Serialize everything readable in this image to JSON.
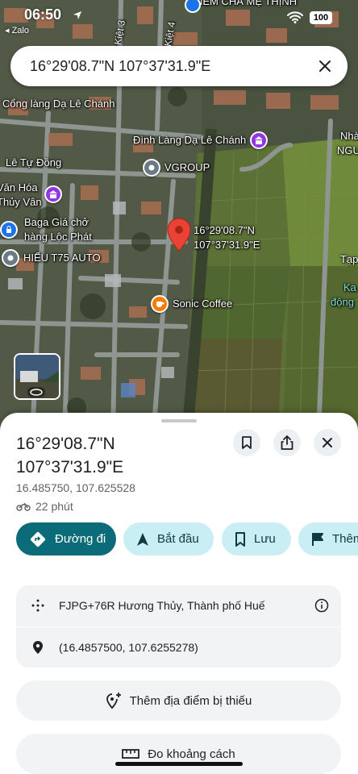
{
  "status_bar": {
    "time": "06:50",
    "back_app": "◂ Zalo",
    "battery": "100"
  },
  "search": {
    "query": "16°29'08.7\"N 107°37'31.9\"E"
  },
  "map": {
    "labels": {
      "nem_cha": "NEM CHẢ MẸ THỊNH",
      "kiet3": "Kiệt 3",
      "kiet4": "Kiệt 4",
      "cong_lang": "Cổng làng Dạ Lê Chánh",
      "dinh_lang": "Đình Làng Dạ Lê Chánh",
      "le_tu_dong": "Lê Tự Đồng",
      "vgroup": "VGROUP",
      "van_hoa_1": "Văn Hóa",
      "van_hoa_2": "Thủy Vân",
      "baga_1": "Baga Giá chở",
      "baga_2": "hàng Lộc Phát",
      "hieu": "HIẾU T75 AUTO",
      "pin_1": "16°29'08.7\"N",
      "pin_2": "107°37'31.9\"E",
      "sonic": "Sonic Coffee",
      "edge_nha": "Nhà",
      "edge_ngu": "NGU",
      "edge_tap": "Tạp",
      "edge_ka": "Ka",
      "edge_dong": "động"
    }
  },
  "sheet": {
    "title": "16°29'08.7\"N 107°37'31.9\"E",
    "decimal_coords": "16.485750, 107.625528",
    "eta": "22 phút",
    "chips": {
      "directions": "Đường đi",
      "start": "Bắt đầu",
      "save": "Lưu",
      "more": "Thêm"
    },
    "plus_code": "FJPG+76R Hương Thủy, Thành phố Huế",
    "coords_paren": "(16.4857500, 107.6255278)",
    "add_missing": "Thêm địa điểm bị thiếu",
    "measure": "Đo khoảng cách"
  },
  "colors": {
    "primary_teal": "#0b6b78",
    "chip_light": "#c9eff5",
    "pin_red": "#ea4335",
    "poi_purple": "#9334e6",
    "poi_gray": "#6b7a84",
    "poi_orange": "#f57c00",
    "poi_blue": "#1a73e8"
  }
}
